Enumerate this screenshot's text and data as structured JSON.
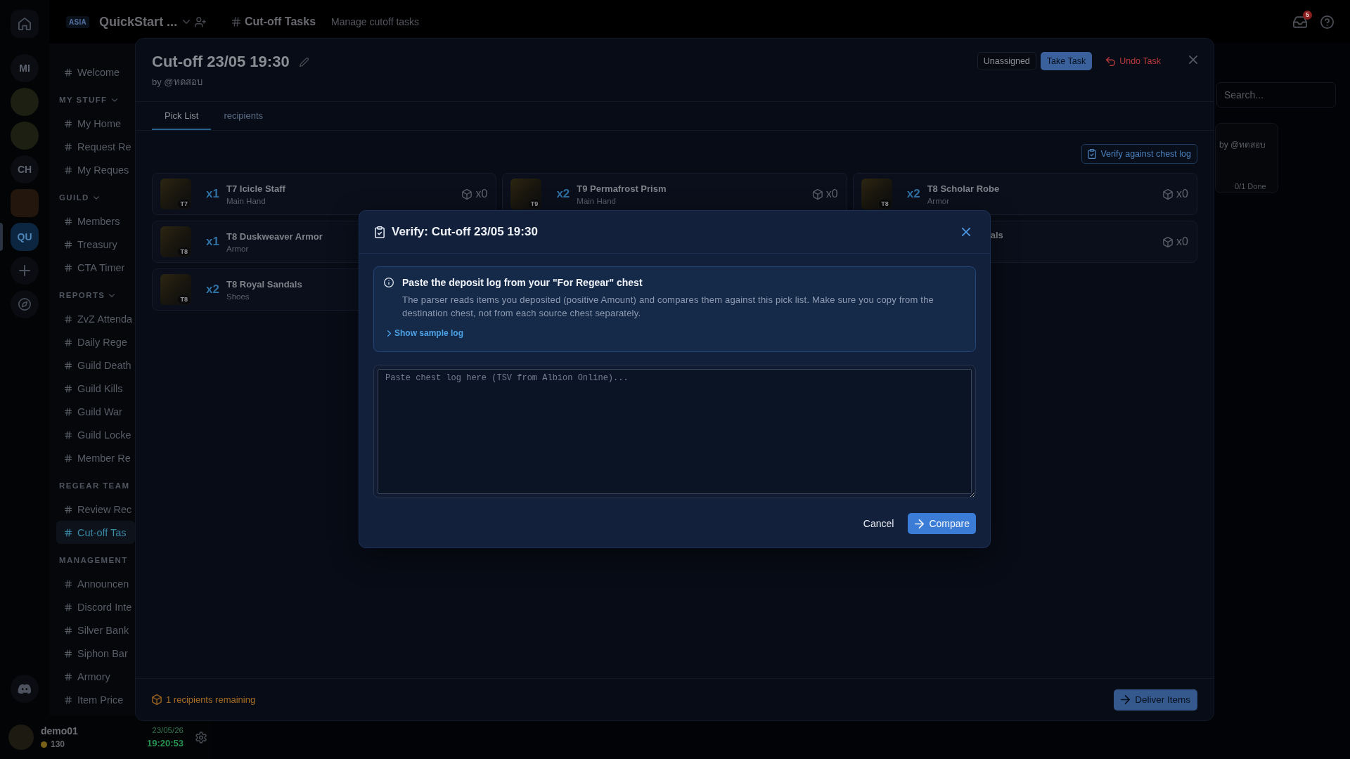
{
  "servers": [
    {
      "kind": "initials",
      "label": "MI",
      "selected": false
    },
    {
      "kind": "avatar",
      "selected": false
    },
    {
      "kind": "avatar",
      "selected": false
    },
    {
      "kind": "initials",
      "label": "CH",
      "selected": false
    },
    {
      "kind": "image",
      "selected": false
    },
    {
      "kind": "initials",
      "label": "QU",
      "selected": true
    }
  ],
  "header": {
    "region": "ASIA",
    "server_name": "QuickStart ...",
    "channel": "Cut-off Tasks",
    "description": "Manage cutoff tasks",
    "notifications": "5"
  },
  "sidebar": {
    "items": [
      {
        "label": "Welcome",
        "selected": false
      }
    ],
    "sections": [
      {
        "title": "MY STUFF",
        "expanded": true,
        "items": [
          {
            "label": "My Home",
            "selected": false
          },
          {
            "label": "Request Re",
            "selected": false
          },
          {
            "label": "My Reques",
            "selected": false
          }
        ]
      },
      {
        "title": "GUILD",
        "expanded": true,
        "items": [
          {
            "label": "Members",
            "selected": false
          },
          {
            "label": "Treasury",
            "selected": false
          },
          {
            "label": "CTA Timer",
            "selected": false
          }
        ]
      },
      {
        "title": "REPORTS",
        "expanded": true,
        "items": [
          {
            "label": "ZvZ Attenda",
            "selected": false
          },
          {
            "label": "Daily Rege",
            "selected": false
          },
          {
            "label": "Guild Death",
            "selected": false
          },
          {
            "label": "Guild Kills",
            "selected": false
          },
          {
            "label": "Guild War",
            "selected": false
          },
          {
            "label": "Guild Locke",
            "selected": false
          },
          {
            "label": "Member Re",
            "selected": false
          }
        ]
      },
      {
        "title": "REGEAR TEAM",
        "items": [
          {
            "label": "Review Rec",
            "selected": false
          },
          {
            "label": "Cut-off Tas",
            "selected": true
          }
        ]
      },
      {
        "title": "MANAGEMENT",
        "items": [
          {
            "label": "Announcen",
            "selected": false
          },
          {
            "label": "Discord Inte",
            "selected": false
          },
          {
            "label": "Silver Bank",
            "selected": false
          },
          {
            "label": "Siphon Bar",
            "selected": false
          },
          {
            "label": "Armory",
            "selected": false
          },
          {
            "label": "Item Price",
            "selected": false
          }
        ]
      }
    ]
  },
  "user": {
    "name": "demo01",
    "coins": "130",
    "date": "23/05/26",
    "time": "19:20:53"
  },
  "background": {
    "search": {
      "placeholder": "Search..."
    },
    "task_card": {
      "author": "by @ทดสอบ",
      "progress": "0/1 Done"
    }
  },
  "task_modal": {
    "title": "Cut-off 23/05 19:30",
    "author": "by @ทดสอบ",
    "status": "Unassigned",
    "actions": [
      {
        "kind": "primary",
        "label": "Take Task"
      },
      {
        "kind": "danger",
        "label": "Undo Task"
      }
    ],
    "tabs": [
      {
        "label": "Pick List",
        "selected": true
      },
      {
        "label": "recipients",
        "selected": false
      }
    ],
    "verify_button": "Verify against chest log",
    "items": [
      {
        "kind": "full",
        "tier": "T7",
        "quantity": "x1",
        "name": "T7 Icicle Staff",
        "slot": "Main Hand",
        "have": "x0"
      },
      {
        "kind": "full",
        "tier": "T9",
        "quantity": "x2",
        "name": "T9 Permafrost Prism",
        "slot": "Main Hand",
        "have": "x0"
      },
      {
        "kind": "full",
        "tier": "T8",
        "quantity": "x2",
        "name": "T8 Scholar Robe",
        "slot": "Armor",
        "have": "x0"
      },
      {
        "kind": "full",
        "tier": "T8",
        "quantity": "x1",
        "name": "T8 Duskweaver Armor",
        "slot": "Armor"
      },
      {
        "kind": "partial",
        "name": "als",
        "have": "x0"
      },
      {
        "kind": "full",
        "tier": "T8",
        "quantity": "x2",
        "name": "T8 Royal Sandals",
        "slot": "Shoes"
      }
    ],
    "footer": {
      "remaining": "1 recipients remaining",
      "deliver": "Deliver Items"
    }
  },
  "verify_dialog": {
    "title": "Verify: Cut-off 23/05 19:30",
    "info": {
      "title": "Paste the deposit log from your \"For Regear\" chest",
      "body": "The parser reads items you deposited (positive Amount) and compares them against this pick list. Make sure you copy from the destination chest, not from each source chest separately.",
      "toggle": "Show sample log",
      "expanded": false
    },
    "log_field": {
      "placeholder": "Paste chest log here (TSV from Albion Online)..."
    },
    "buttons": [
      {
        "kind": "plain",
        "label": "Cancel"
      },
      {
        "kind": "primary",
        "label": "Compare"
      }
    ]
  }
}
